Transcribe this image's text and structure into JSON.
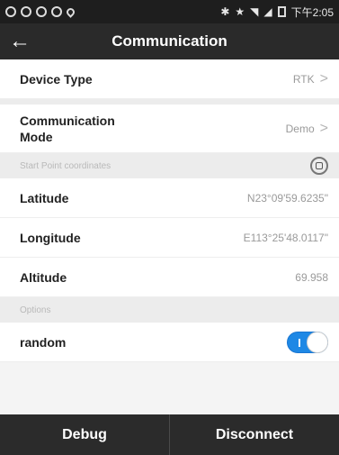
{
  "status_bar": {
    "time": "下午2:05",
    "left_icons": [
      "notification-icon",
      "notification-icon",
      "notification-icon",
      "notification-icon",
      "location-icon"
    ],
    "right_icons": [
      "bluetooth-icon",
      "star-icon",
      "wifi-icon",
      "signal-icon",
      "battery-icon"
    ]
  },
  "app_bar": {
    "title": "Communication",
    "back_glyph": "←"
  },
  "rows": {
    "device_type": {
      "label": "Device Type",
      "value": "RTK"
    },
    "communication_mode": {
      "label_line1": "Communication",
      "label_line2": "Mode",
      "value": "Demo"
    }
  },
  "sections": {
    "start_point": "Start Point coordinates",
    "options": "Options"
  },
  "coordinates": {
    "latitude": {
      "label": "Latitude",
      "value": "N23°09'59.6235\""
    },
    "longitude": {
      "label": "Longitude",
      "value": "E113°25'48.0117\""
    },
    "altitude": {
      "label": "Altitude",
      "value": "69.958"
    }
  },
  "options": {
    "random": {
      "label": "random",
      "enabled": true
    }
  },
  "bottom_bar": {
    "debug": "Debug",
    "disconnect": "Disconnect"
  },
  "colors": {
    "status_bar_bg": "#1e1e1e",
    "app_bar_bg": "#2a2a2a",
    "toggle_on": "#1e88e5",
    "bottom_bar_bg": "#2b2b2b"
  }
}
